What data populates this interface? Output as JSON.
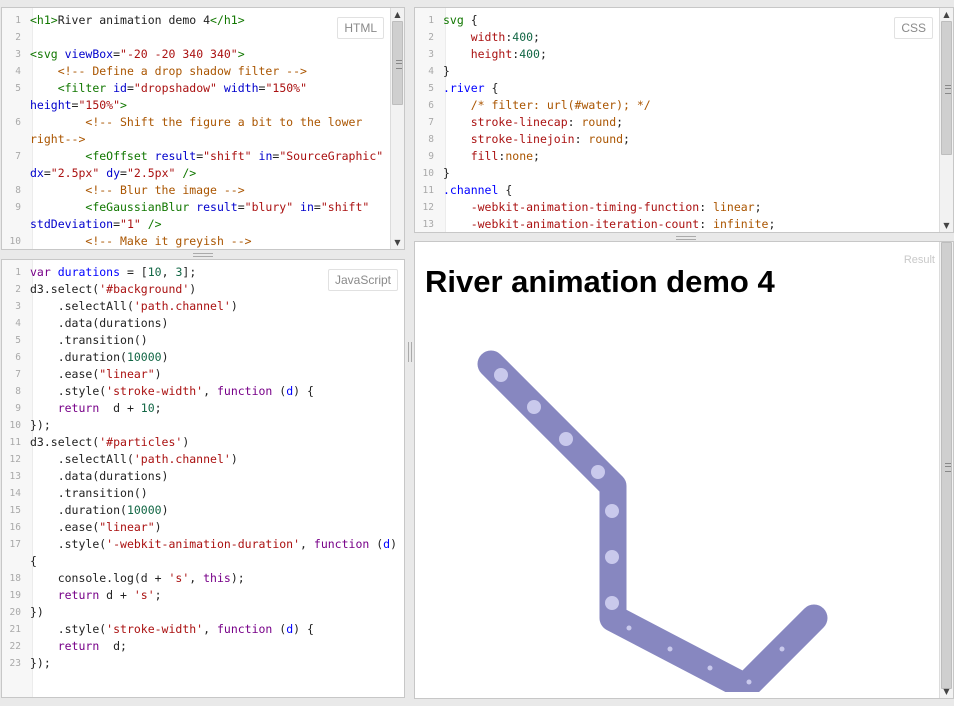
{
  "panels": {
    "html_tag": "HTML",
    "css_tag": "CSS",
    "js_tag": "JavaScript",
    "result_tag": "Result"
  },
  "html_code": [
    [
      [
        "tg",
        "<h1>"
      ],
      [
        "",
        "River animation demo 4"
      ],
      [
        "tg",
        "</h1>"
      ]
    ],
    [],
    [
      [
        "tg",
        "<svg "
      ],
      [
        "at",
        "viewBox"
      ],
      [
        "",
        "="
      ],
      [
        "st",
        "\"-20 -20 340 340\""
      ],
      [
        "tg",
        ">"
      ]
    ],
    [
      [
        "",
        "    "
      ],
      [
        "cm",
        "<!-- Define a drop shadow filter -->"
      ]
    ],
    [
      [
        "",
        "    "
      ],
      [
        "tg",
        "<filter "
      ],
      [
        "at",
        "id"
      ],
      [
        "",
        "="
      ],
      [
        "st",
        "\"dropshadow\""
      ],
      [
        "",
        ""
      ],
      [
        "at",
        " width"
      ],
      [
        "",
        "="
      ],
      [
        "st",
        "\"150%\""
      ],
      [
        "at",
        " height"
      ],
      [
        "",
        "="
      ],
      [
        "st",
        "\"150%\""
      ],
      [
        "tg",
        ">"
      ]
    ],
    [
      [
        "",
        "        "
      ],
      [
        "cm",
        "<!-- Shift the figure a bit to the lower right-->"
      ]
    ],
    [
      [
        "",
        "        "
      ],
      [
        "tg",
        "<feOffset "
      ],
      [
        "at",
        "result"
      ],
      [
        "",
        "="
      ],
      [
        "st",
        "\"shift\""
      ],
      [
        "at",
        " in"
      ],
      [
        "",
        "="
      ],
      [
        "st",
        "\"SourceGraphic\""
      ],
      [
        "at",
        " dx"
      ],
      [
        "",
        "="
      ],
      [
        "st",
        "\"2.5px\""
      ],
      [
        "at",
        " dy"
      ],
      [
        "",
        "="
      ],
      [
        "st",
        "\"2.5px\""
      ],
      [
        "tg",
        " />"
      ]
    ],
    [
      [
        "",
        "        "
      ],
      [
        "cm",
        "<!-- Blur the image -->"
      ]
    ],
    [
      [
        "",
        "        "
      ],
      [
        "tg",
        "<feGaussianBlur "
      ],
      [
        "at",
        "result"
      ],
      [
        "",
        "="
      ],
      [
        "st",
        "\"blury\""
      ],
      [
        "at",
        " in"
      ],
      [
        "",
        "="
      ],
      [
        "st",
        "\"shift\""
      ],
      [
        "at",
        " stdDeviation"
      ],
      [
        "",
        "="
      ],
      [
        "st",
        "\"1\""
      ],
      [
        "tg",
        " />"
      ]
    ],
    [
      [
        "",
        "        "
      ],
      [
        "cm",
        "<!-- Make it greyish -->"
      ]
    ]
  ],
  "css_code": [
    [
      [
        "sl",
        "svg"
      ],
      [
        "",
        ""
      ],
      [
        "",
        " {"
      ]
    ],
    [
      [
        "",
        "    "
      ],
      [
        "pr",
        "width"
      ],
      [
        "",
        ":"
      ],
      [
        "nm",
        "400"
      ],
      [
        "",
        ";"
      ]
    ],
    [
      [
        "",
        "    "
      ],
      [
        "pr",
        "height"
      ],
      [
        "",
        ":"
      ],
      [
        "nm",
        "400"
      ],
      [
        "",
        ";"
      ]
    ],
    [
      [
        "",
        "}"
      ]
    ],
    [
      [
        "df",
        ".river"
      ],
      [
        "",
        " {"
      ]
    ],
    [
      [
        "",
        "    "
      ],
      [
        "cm",
        "/* filter: url(#water); */"
      ]
    ],
    [
      [
        "",
        "    "
      ],
      [
        "pr",
        "stroke-linecap"
      ],
      [
        "",
        ": "
      ],
      [
        "vl",
        "round"
      ],
      [
        "",
        ";"
      ]
    ],
    [
      [
        "",
        "    "
      ],
      [
        "pr",
        "stroke-linejoin"
      ],
      [
        "",
        ": "
      ],
      [
        "vl",
        "round"
      ],
      [
        "",
        ";"
      ]
    ],
    [
      [
        "",
        "    "
      ],
      [
        "pr",
        "fill"
      ],
      [
        "",
        ":"
      ],
      [
        "vl",
        "none"
      ],
      [
        "",
        ";"
      ]
    ],
    [
      [
        "",
        "}"
      ]
    ],
    [
      [
        "df",
        ".channel"
      ],
      [
        "",
        " {"
      ]
    ],
    [
      [
        "",
        "    "
      ],
      [
        "pr",
        "-webkit-animation-timing-function"
      ],
      [
        "",
        ": "
      ],
      [
        "vl",
        "linear"
      ],
      [
        "",
        ";"
      ]
    ],
    [
      [
        "",
        "    "
      ],
      [
        "pr",
        "-webkit-animation-iteration-count"
      ],
      [
        "",
        ": "
      ],
      [
        "vl",
        "infinite"
      ],
      [
        "",
        ";"
      ]
    ]
  ],
  "js_code": [
    [
      [
        "kw",
        "var"
      ],
      [
        "",
        " "
      ],
      [
        "df",
        "durations"
      ],
      [
        "",
        " = ["
      ],
      [
        "nm",
        "10"
      ],
      [
        "",
        ", "
      ],
      [
        "nm",
        "3"
      ],
      [
        "",
        "];"
      ]
    ],
    [
      [
        "",
        "d3.select("
      ],
      [
        "st",
        "'#background'"
      ],
      [
        "",
        ")"
      ]
    ],
    [
      [
        "",
        "    .selectAll("
      ],
      [
        "st",
        "'path.channel'"
      ],
      [
        "",
        ")"
      ]
    ],
    [
      [
        "",
        "    .data(durations)"
      ]
    ],
    [
      [
        "",
        "    .transition()"
      ]
    ],
    [
      [
        "",
        "    .duration("
      ],
      [
        "nm",
        "10000"
      ],
      [
        "",
        ")"
      ]
    ],
    [
      [
        "",
        "    .ease("
      ],
      [
        "st",
        "\"linear\""
      ],
      [
        "",
        ")"
      ]
    ],
    [
      [
        "",
        "    .style("
      ],
      [
        "st",
        "'stroke-width'"
      ],
      [
        "",
        ", "
      ],
      [
        "kw",
        "function"
      ],
      [
        "",
        " ("
      ],
      [
        "df",
        "d"
      ],
      [
        "",
        ") {"
      ]
    ],
    [
      [
        "",
        "    "
      ],
      [
        "kw",
        "return"
      ],
      [
        "",
        "  d + "
      ],
      [
        "nm",
        "10"
      ],
      [
        "",
        ";"
      ]
    ],
    [
      [
        "",
        "});"
      ]
    ],
    [
      [
        "",
        "d3.select("
      ],
      [
        "st",
        "'#particles'"
      ],
      [
        "",
        ")"
      ]
    ],
    [
      [
        "",
        "    .selectAll("
      ],
      [
        "st",
        "'path.channel'"
      ],
      [
        "",
        ")"
      ]
    ],
    [
      [
        "",
        "    .data(durations)"
      ]
    ],
    [
      [
        "",
        "    .transition()"
      ]
    ],
    [
      [
        "",
        "    .duration("
      ],
      [
        "nm",
        "10000"
      ],
      [
        "",
        ")"
      ]
    ],
    [
      [
        "",
        "    .ease("
      ],
      [
        "st",
        "\"linear\""
      ],
      [
        "",
        ")"
      ]
    ],
    [
      [
        "",
        "    .style("
      ],
      [
        "st",
        "'-webkit-animation-duration'"
      ],
      [
        "",
        ", "
      ],
      [
        "kw",
        "function"
      ],
      [
        "",
        " ("
      ],
      [
        "df",
        "d"
      ],
      [
        "",
        ") {"
      ]
    ],
    [
      [
        "",
        "    console.log(d + "
      ],
      [
        "st",
        "'s'"
      ],
      [
        "",
        ", "
      ],
      [
        "kw",
        "this"
      ],
      [
        "",
        ");"
      ]
    ],
    [
      [
        "",
        "    "
      ],
      [
        "kw",
        "return"
      ],
      [
        "",
        " d + "
      ],
      [
        "st",
        "'s'"
      ],
      [
        "",
        ";"
      ]
    ],
    [
      [
        "",
        "})"
      ]
    ],
    [
      [
        "",
        "    .style("
      ],
      [
        "st",
        "'stroke-width'"
      ],
      [
        "",
        ", "
      ],
      [
        "kw",
        "function"
      ],
      [
        "",
        " ("
      ],
      [
        "df",
        "d"
      ],
      [
        "",
        ") {"
      ]
    ],
    [
      [
        "",
        "    "
      ],
      [
        "kw",
        "return"
      ],
      [
        "",
        "  d;"
      ]
    ],
    [
      [
        "",
        "});"
      ]
    ]
  ],
  "result": {
    "title": "River animation demo 4"
  },
  "colors": {
    "river": "#8787c0",
    "particle": "#c9c9ec",
    "panel_bg": "#ffffff",
    "workspace_bg": "#e9e9e9"
  }
}
